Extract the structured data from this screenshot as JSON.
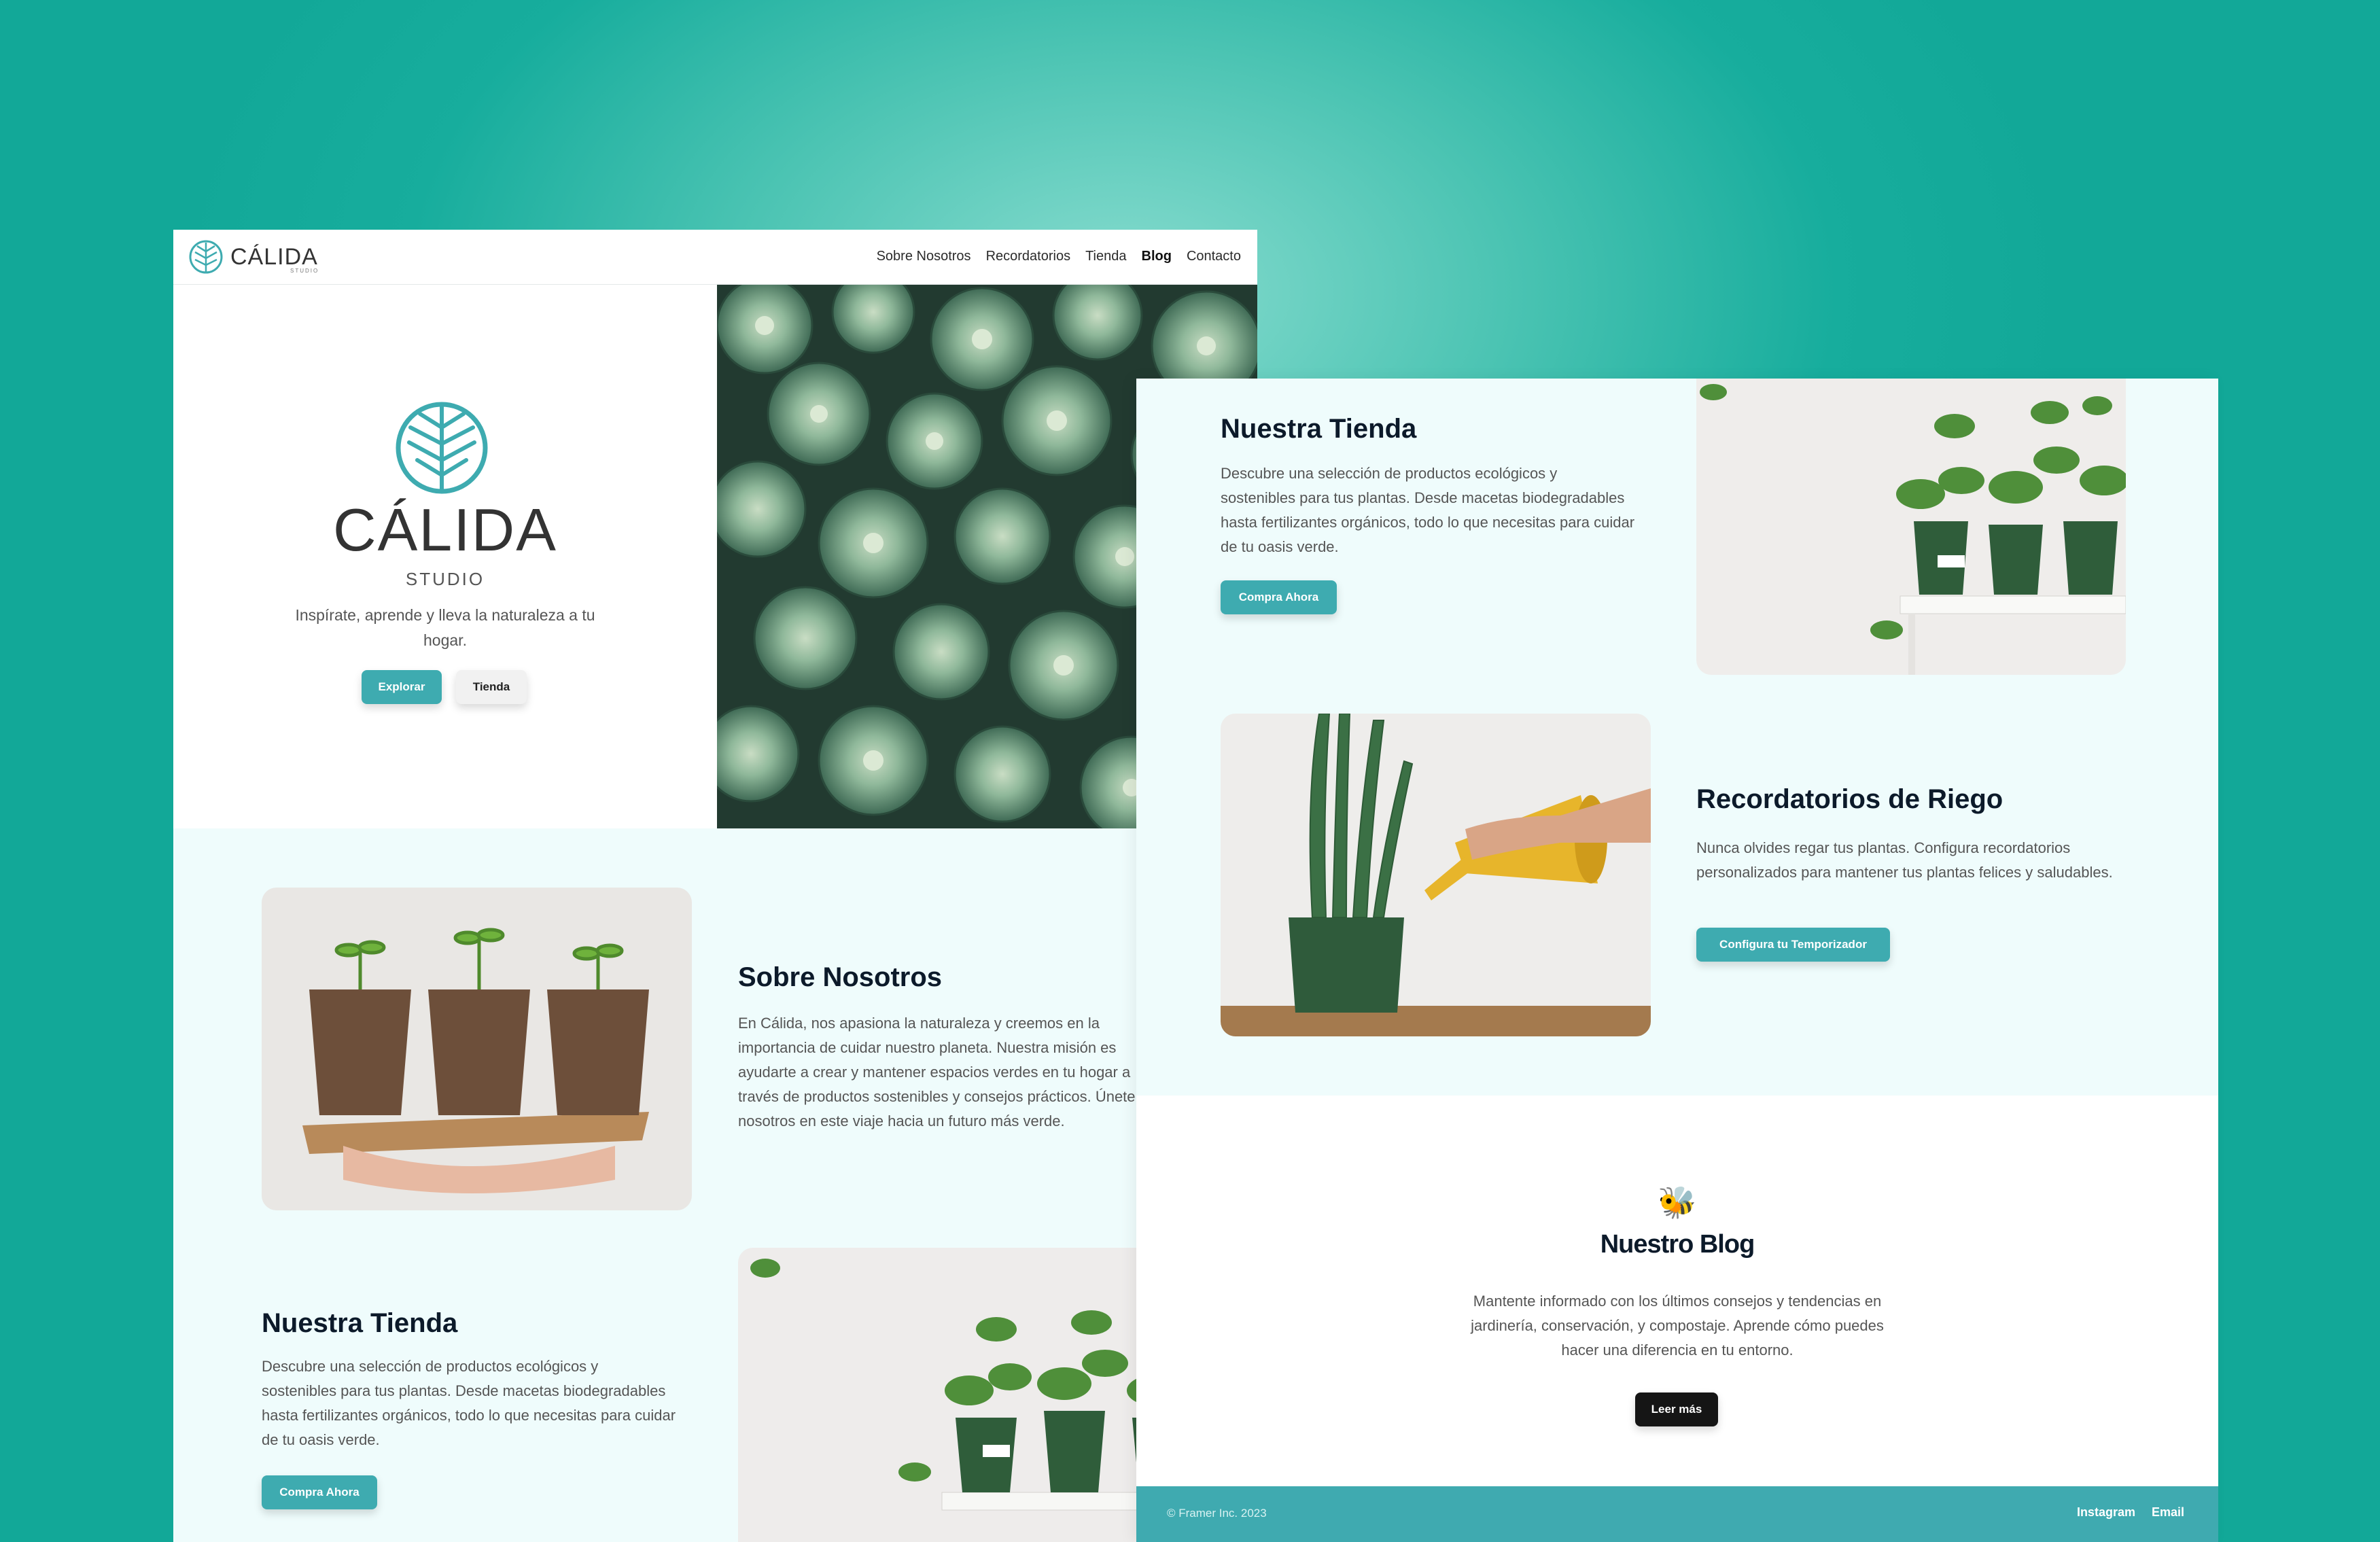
{
  "nav": {
    "brand": "CÁLIDA",
    "brand_sub": "STUDIO",
    "links": [
      "Sobre Nosotros",
      "Recordatorios",
      "Tienda",
      "Blog",
      "Contacto"
    ]
  },
  "hero": {
    "brand": "CÁLIDA",
    "studio": "STUDIO",
    "tagline": "Inspírate, aprende y lleva la naturaleza a tu hogar.",
    "explore_label": "Explorar",
    "shop_label": "Tienda"
  },
  "about": {
    "title": "Sobre Nosotros",
    "body": "En Cálida, nos apasiona la naturaleza y creemos en la importancia de cuidar nuestro planeta. Nuestra misión es ayudarte a crear y mantener espacios verdes en tu hogar a través de productos sostenibles y consejos prácticos. Únete a nosotros en este viaje hacia un futuro más verde."
  },
  "shop": {
    "title": "Nuestra Tienda",
    "body": "Descubre una selección de productos ecológicos y sostenibles para tus plantas. Desde macetas biodegradables hasta fertilizantes orgánicos, todo lo que necesitas para cuidar de tu oasis verde.",
    "button_label": "Compra Ahora"
  },
  "reminders": {
    "title": "Recordatorios de Riego",
    "body": "Nunca olvides regar tus plantas. Configura recordatorios personalizados para mantener tus plantas felices y saludables.",
    "button_label": "Configura tu Temporizador"
  },
  "blog": {
    "emoji": "🐝",
    "title": "Nuestro Blog",
    "body": "Mantente informado con los últimos consejos y tendencias en jardinería, conservación, y compostaje. Aprende cómo puedes hacer una diferencia en tu entorno.",
    "button_label": "Leer más"
  },
  "footer": {
    "copyright": "© Framer Inc. 2023",
    "links": [
      "Instagram",
      "Email"
    ]
  },
  "colors": {
    "background": "#12a898",
    "accent": "#3eabb0",
    "section_bg": "#effcfc",
    "dark_button": "#151515"
  }
}
